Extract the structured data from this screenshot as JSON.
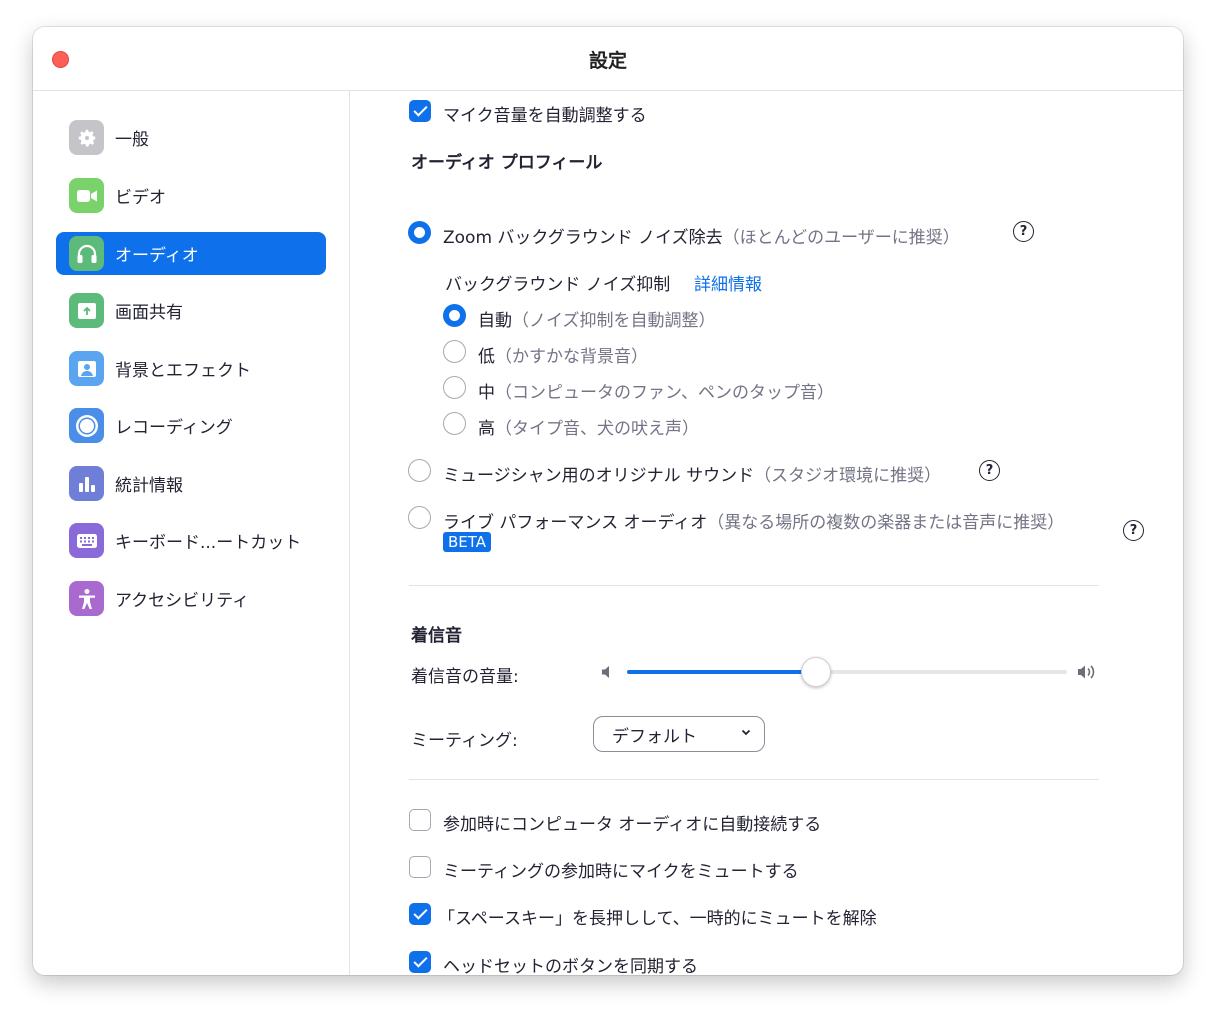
{
  "window": {
    "title": "設定"
  },
  "sidebar": {
    "items": [
      {
        "label": "一般",
        "icon": "gear-icon",
        "color": "#c4c4c9",
        "active": false
      },
      {
        "label": "ビデオ",
        "icon": "video-camera-icon",
        "color": "#7ad26a",
        "active": false
      },
      {
        "label": "オーディオ",
        "icon": "headphones-icon",
        "color": "#5cba7a",
        "active": true
      },
      {
        "label": "画面共有",
        "icon": "share-screen-icon",
        "color": "#5cba7a",
        "active": false
      },
      {
        "label": "背景とエフェクト",
        "icon": "background-person-icon",
        "color": "#5aa5f0",
        "active": false
      },
      {
        "label": "レコーディング",
        "icon": "record-icon",
        "color": "#4a8ee8",
        "active": false
      },
      {
        "label": "統計情報",
        "icon": "bar-chart-icon",
        "color": "#6f7fd8",
        "active": false
      },
      {
        "label": "キーボード...ートカット",
        "icon": "keyboard-icon",
        "color": "#8a6ad8",
        "active": false
      },
      {
        "label": "アクセシビリティ",
        "icon": "accessibility-icon",
        "color": "#a96ad0",
        "active": false
      }
    ]
  },
  "audio": {
    "auto_adjust_mic": {
      "label": "マイク音量を自動調整する",
      "checked": true
    },
    "profile_heading": "オーディオ プロフィール",
    "profile_zoom": {
      "label": "Zoom バックグラウンド ノイズ除去",
      "hint": "（ほとんどのユーザーに推奨）",
      "selected": true
    },
    "noise_heading": "バックグラウンド ノイズ抑制",
    "noise_link": "詳細情報",
    "noise_options": [
      {
        "label": "自動",
        "hint": "（ノイズ抑制を自動調整）",
        "selected": true
      },
      {
        "label": "低",
        "hint": "（かすかな背景音）",
        "selected": false
      },
      {
        "label": "中",
        "hint": "（コンピュータのファン、ペンのタップ音）",
        "selected": false
      },
      {
        "label": "高",
        "hint": "（タイプ音、犬の吠え声）",
        "selected": false
      }
    ],
    "profile_musician": {
      "label": "ミュージシャン用のオリジナル サウンド",
      "hint": "（スタジオ環境に推奨）",
      "selected": false
    },
    "profile_live": {
      "label": "ライブ パフォーマンス オーディオ",
      "hint": "（異なる場所の複数の楽器または音声に推奨）",
      "selected": false,
      "badge": "BETA"
    },
    "help_glyph": "?"
  },
  "ringtone": {
    "heading": "着信音",
    "volume_label": "着信音の音量:",
    "volume_fraction": 0.43,
    "meeting_label": "ミーティング:",
    "meeting_value": "デフォルト"
  },
  "options": [
    {
      "label": "参加時にコンピュータ オーディオに自動接続する",
      "checked": false
    },
    {
      "label": "ミーティングの参加時にマイクをミュートする",
      "checked": false
    },
    {
      "label": "「スペースキー」を長押しして、一時的にミュートを解除",
      "checked": true
    },
    {
      "label": "ヘッドセットのボタンを同期する",
      "checked": true
    }
  ],
  "colors": {
    "accent": "#0e71eb",
    "close": "#fe5f57"
  }
}
